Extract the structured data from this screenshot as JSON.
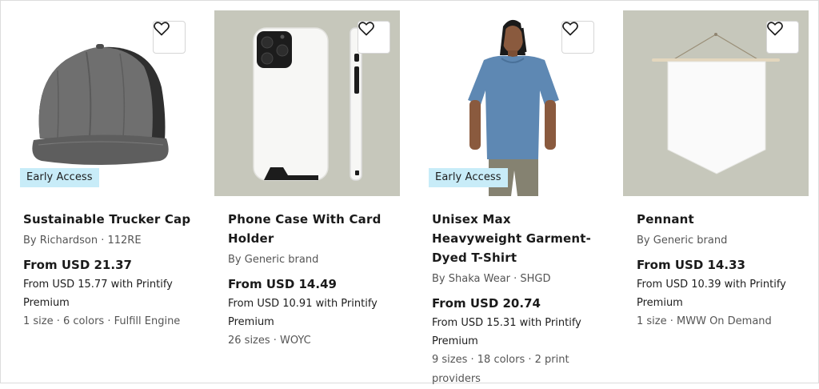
{
  "products": [
    {
      "badge": "Early Access",
      "title": "Sustainable Trucker Cap",
      "by": "By Richardson · 112RE",
      "price": "From USD 21.37",
      "premium": "From USD 15.77 with Printify Premium",
      "meta": "1 size · 6 colors · Fulfill Engine",
      "icon": "trucker-cap-image"
    },
    {
      "badge": "",
      "title": "Phone Case With Card Holder",
      "by": "By Generic brand",
      "price": "From USD 14.49",
      "premium": "From USD 10.91 with Printify Premium",
      "meta": "26 sizes · WOYC",
      "icon": "phone-case-image"
    },
    {
      "badge": "Early Access",
      "title": "Unisex Max Heavyweight Garment-Dyed T-Shirt",
      "by": "By Shaka Wear · SHGD",
      "price": "From USD 20.74",
      "premium": "From USD 15.31 with Printify Premium",
      "meta": "9 sizes · 18 colors · 2 print providers",
      "icon": "t-shirt-model-image"
    },
    {
      "badge": "",
      "title": "Pennant",
      "by": "By Generic brand",
      "price": "From USD 14.33",
      "premium": "From USD 10.39 with Printify Premium",
      "meta": "1 size · MWW On Demand",
      "icon": "pennant-image"
    }
  ],
  "colors": {
    "badge_bg": "#c8ecf8",
    "sage_bg": "#c6c7bb",
    "text": "#1a1a1a",
    "muted": "#555555"
  },
  "favorite_icon": "heart-outline-icon"
}
